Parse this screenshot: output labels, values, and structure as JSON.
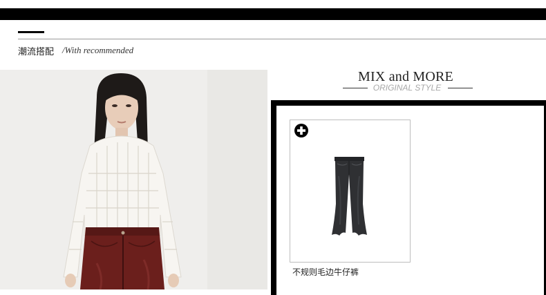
{
  "section": {
    "title": "潮流搭配",
    "subtitle": "/With recommended"
  },
  "mix": {
    "title": "MIX and MORE",
    "subtitle": "ORIGINAL STYLE"
  },
  "products": [
    {
      "name": "不规则毛边牛仔裤",
      "icon": "plus-circle-icon",
      "image": "flared-jeans"
    }
  ],
  "colors": {
    "bar": "#000000",
    "rule": "#9a9a9a",
    "subtitle_gray": "#a8a8a8"
  }
}
